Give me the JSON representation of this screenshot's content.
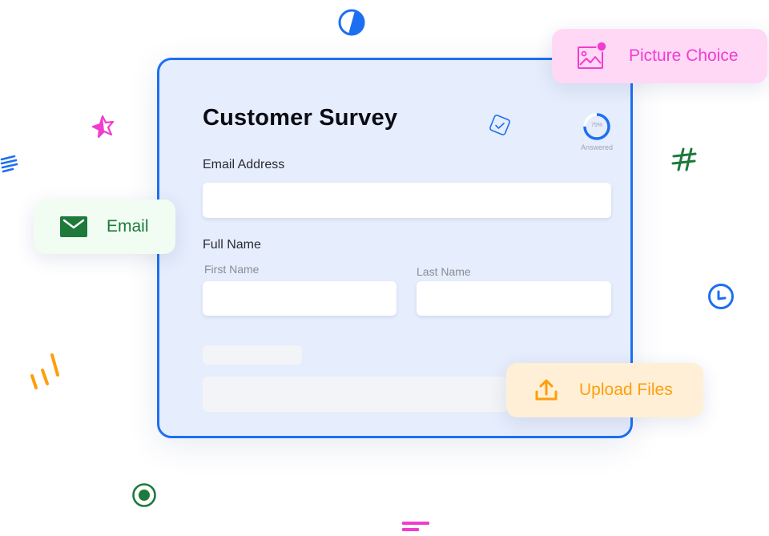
{
  "form": {
    "title": "Customer Survey",
    "progress": {
      "percent_label": "75%",
      "value": 0.75,
      "caption": "Answered"
    },
    "email_label": "Email Address",
    "email_value": "",
    "full_name_label": "Full Name",
    "first_name_label": "First Name",
    "first_name_value": "",
    "last_name_label": "Last Name",
    "last_name_value": ""
  },
  "chips": {
    "picture_choice": {
      "label": "Picture Choice",
      "icon": "image-icon",
      "color": "#f13dcf"
    },
    "email": {
      "label": "Email",
      "icon": "envelope-icon",
      "color": "#1d7a3b"
    },
    "upload_files": {
      "label": "Upload Files",
      "icon": "upload-icon",
      "color": "#ff9e0b"
    }
  },
  "colors": {
    "accent_blue": "#1d6ff2",
    "card_background": "#e6edfc",
    "pink": "#f13dcf",
    "green": "#1d7a3b",
    "orange": "#ff9e0b"
  },
  "decorations": [
    "half-circle-icon",
    "star-icon",
    "lines-icon",
    "hashtag-icon",
    "clock-icon",
    "slash-lines-icon",
    "radio-icon",
    "pink-bars-icon"
  ]
}
